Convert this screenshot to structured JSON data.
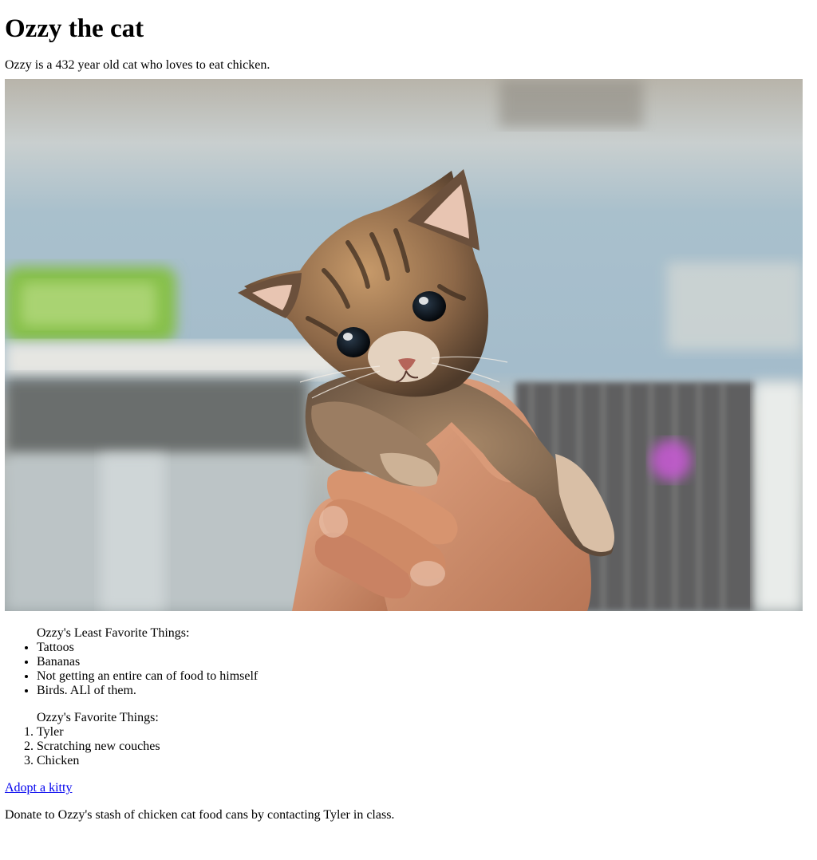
{
  "page": {
    "title": "Ozzy the cat",
    "intro": "Ozzy is a 432 year old cat who loves to eat chicken."
  },
  "photo": {
    "subject": "tabby kitten held in a hand"
  },
  "least_favorites": {
    "caption": "Ozzy's Least Favorite Things:",
    "items": [
      "Tattoos",
      "Bananas",
      "Not getting an entire can of food to himself",
      "Birds. ALl of them."
    ]
  },
  "favorites": {
    "caption": "Ozzy's Favorite Things:",
    "items": [
      "Tyler",
      "Scratching new couches",
      "Chicken"
    ]
  },
  "links": {
    "adopt_label": "Adopt a kitty"
  },
  "footer": {
    "donate_text": "Donate to Ozzy's stash of chicken cat food cans by contacting Tyler in class."
  },
  "colors": {
    "link": "#0000ee",
    "text": "#000000",
    "background": "#ffffff"
  }
}
